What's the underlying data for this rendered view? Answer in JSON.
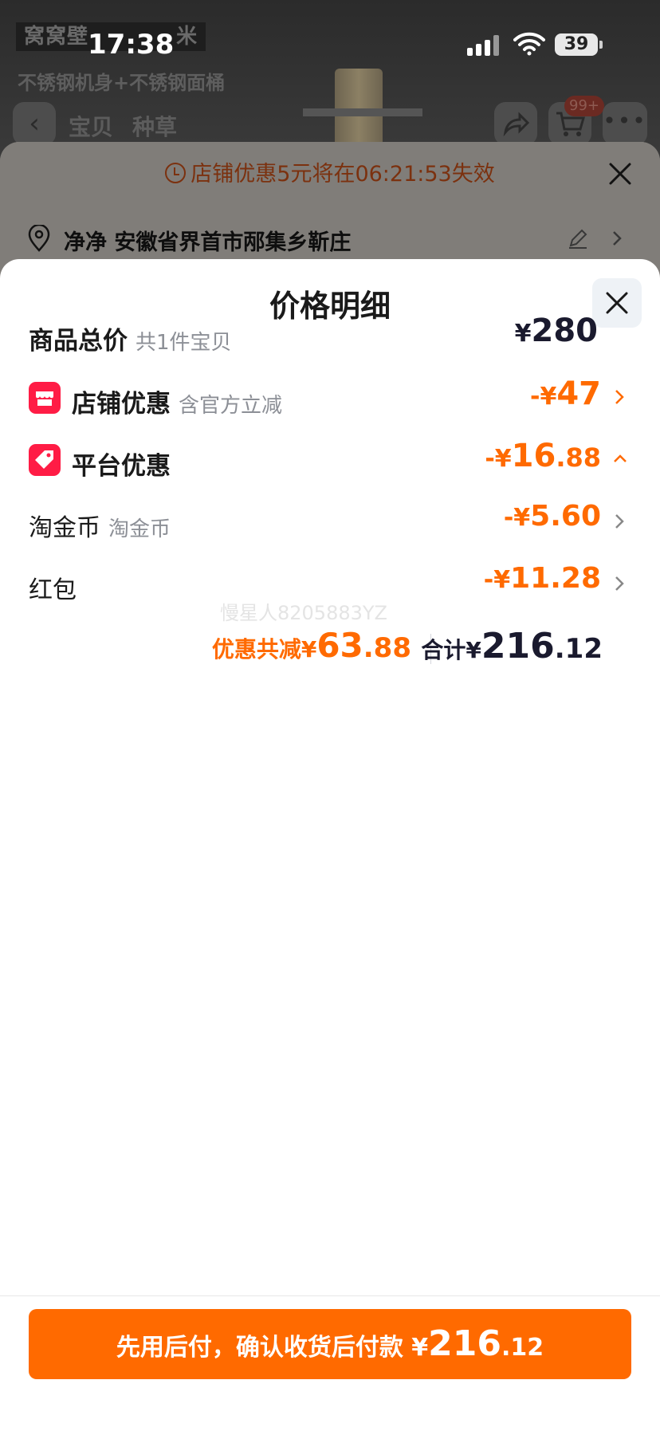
{
  "status_bar": {
    "time": "17:38",
    "battery": "39"
  },
  "background_page": {
    "promo_tag": "窝窝壁",
    "promo_tag_tail": "米",
    "subtitle": "不锈钢机身+不锈钢面桶",
    "tabs": [
      "宝贝",
      "种草"
    ],
    "cart_badge": "99+"
  },
  "order_sheet": {
    "coupon_banner": "店铺优惠5元将在06:21:53失效",
    "address": "净净 安徽省界首市邴集乡靳庄"
  },
  "price_detail": {
    "title": "价格明细",
    "rows": [
      {
        "label": "商品总价",
        "sub": "共1件宝贝",
        "currency": "¥",
        "amount": "280",
        "cents": ""
      },
      {
        "label": "店铺优惠",
        "sub": "含官方立减",
        "minus": "-",
        "currency": "¥",
        "amount": "47",
        "cents": "",
        "icon": "shop-icon"
      },
      {
        "label": "平台优惠",
        "sub": "",
        "minus": "-",
        "currency": "¥",
        "amount": "16",
        "cents": ".88",
        "icon": "tag-icon"
      },
      {
        "label": "淘金币",
        "sub": "淘金币",
        "minus": "-",
        "currency": "¥",
        "amount": "5.60",
        "cents": ""
      },
      {
        "label": "红包",
        "sub": "",
        "minus": "-",
        "currency": "¥",
        "amount": "11.28",
        "cents": ""
      }
    ],
    "watermark": "慢星人8205883YZ",
    "summary": {
      "discount_label": "优惠共减¥",
      "discount_amount": "63",
      "discount_cents": ".88",
      "total_label": "合计¥",
      "total_amount": "216",
      "total_cents": ".12"
    }
  },
  "pay_button": {
    "label": "先用后付，确认收货后付款 ¥",
    "amount": "216",
    "cents": ".12"
  },
  "colors": {
    "accent": "#ff6a00",
    "icon_red": "#ff1c45",
    "text_dark": "#1a1a2e"
  }
}
